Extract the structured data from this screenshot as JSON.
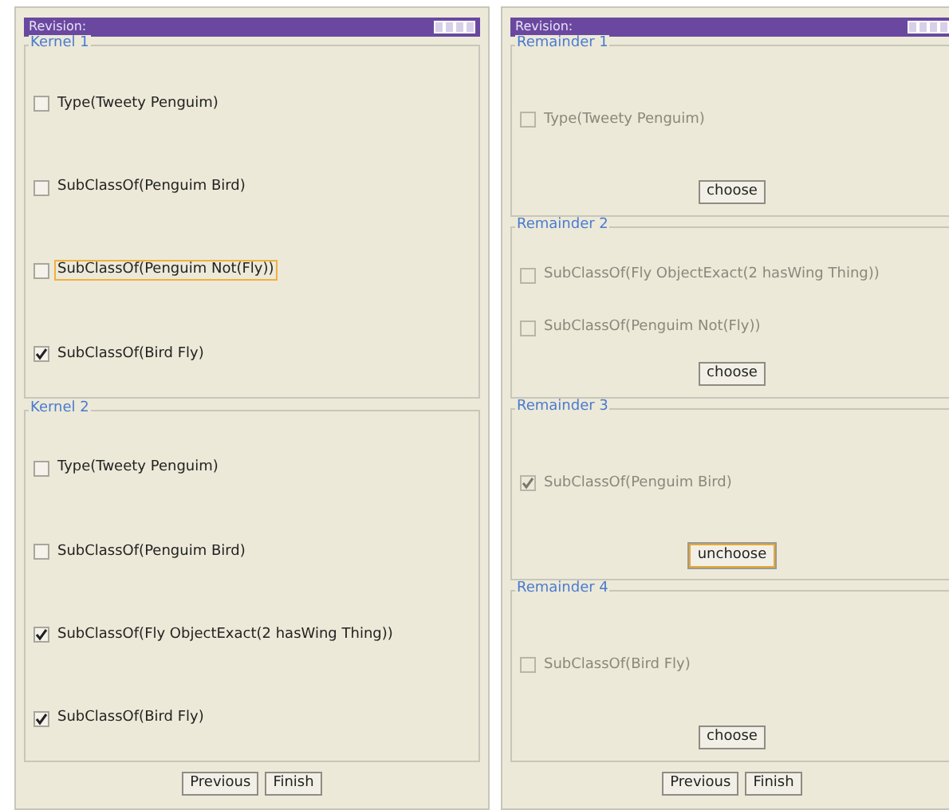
{
  "panels": [
    {
      "title": "Revision:",
      "groups": [
        {
          "title": "Kernel 1",
          "items": [
            {
              "label": "Type(Tweety Penguim)",
              "checked": false,
              "disabled": false,
              "focused": false
            },
            {
              "label": "SubClassOf(Penguim Bird)",
              "checked": false,
              "disabled": false,
              "focused": false
            },
            {
              "label": "SubClassOf(Penguim Not(Fly))",
              "checked": false,
              "disabled": false,
              "focused": true
            },
            {
              "label": "SubClassOf(Bird Fly)",
              "checked": true,
              "disabled": false,
              "focused": false
            }
          ]
        },
        {
          "title": "Kernel 2",
          "items": [
            {
              "label": "Type(Tweety Penguim)",
              "checked": false,
              "disabled": false,
              "focused": false
            },
            {
              "label": "SubClassOf(Penguim Bird)",
              "checked": false,
              "disabled": false,
              "focused": false
            },
            {
              "label": "SubClassOf(Fly ObjectExact(2 hasWing Thing))",
              "checked": true,
              "disabled": false,
              "focused": false
            },
            {
              "label": "SubClassOf(Bird Fly)",
              "checked": true,
              "disabled": false,
              "focused": false
            }
          ]
        }
      ],
      "buttons": [
        "Previous",
        "Finish"
      ]
    },
    {
      "title": "Revision:",
      "groups": [
        {
          "title": "Remainder 1",
          "items": [
            {
              "label": "Type(Tweety Penguim)",
              "checked": false,
              "disabled": true,
              "focused": false
            }
          ],
          "action": {
            "label": "choose",
            "focused": false
          }
        },
        {
          "title": "Remainder 2",
          "items": [
            {
              "label": "SubClassOf(Fly ObjectExact(2 hasWing Thing))",
              "checked": false,
              "disabled": true,
              "focused": false
            },
            {
              "label": "SubClassOf(Penguim Not(Fly))",
              "checked": false,
              "disabled": true,
              "focused": false
            }
          ],
          "action": {
            "label": "choose",
            "focused": false
          }
        },
        {
          "title": "Remainder 3",
          "items": [
            {
              "label": "SubClassOf(Penguim Bird)",
              "checked": true,
              "disabled": true,
              "focused": false
            }
          ],
          "action": {
            "label": "unchoose",
            "focused": true
          }
        },
        {
          "title": "Remainder 4",
          "items": [
            {
              "label": "SubClassOf(Bird Fly)",
              "checked": false,
              "disabled": true,
              "focused": false
            }
          ],
          "action": {
            "label": "choose",
            "focused": false
          }
        }
      ],
      "buttons": [
        "Previous",
        "Finish"
      ]
    }
  ]
}
